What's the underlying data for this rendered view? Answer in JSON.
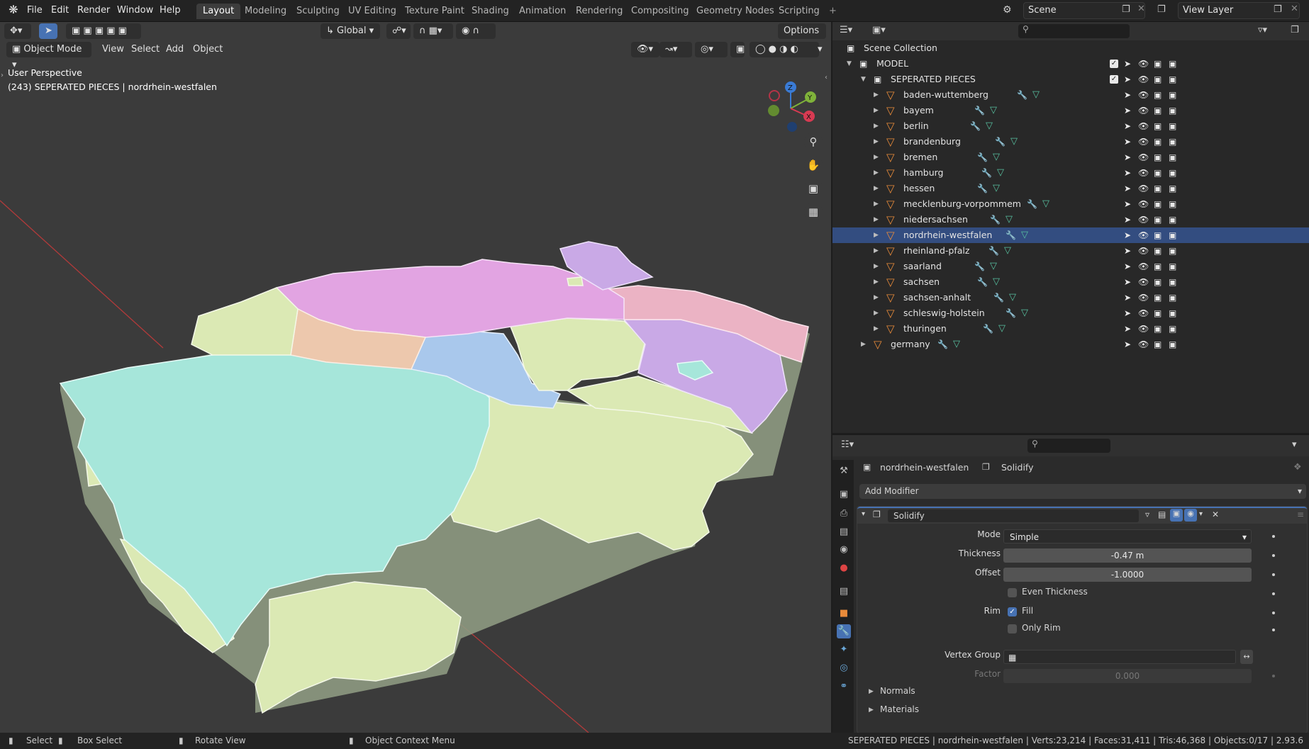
{
  "menu": [
    "File",
    "Edit",
    "Render",
    "Window",
    "Help"
  ],
  "workspaces": [
    "Layout",
    "Modeling",
    "Sculpting",
    "UV Editing",
    "Texture Paint",
    "Shading",
    "Animation",
    "Rendering",
    "Compositing",
    "Geometry Nodes",
    "Scripting"
  ],
  "active_workspace": "Layout",
  "scene": "Scene",
  "view_layer": "View Layer",
  "viewport": {
    "transform": "Global",
    "options": "Options",
    "mode": "Object Mode",
    "menus": [
      "View",
      "Select",
      "Add",
      "Object"
    ],
    "perspective": "User Perspective",
    "info": "(243) SEPERATED PIECES | nordrhein-westfalen",
    "axes": {
      "x": "X",
      "y": "Y",
      "z": "Z"
    }
  },
  "outliner": {
    "root": "Scene Collection",
    "model": "MODEL",
    "collection": "SEPERATED PIECES",
    "items": [
      "baden-wuttemberg",
      "bayem",
      "berlin",
      "brandenburg",
      "bremen",
      "hamburg",
      "hessen",
      "mecklenburg-vorpommem",
      "niedersachsen",
      "nordrhein-westfalen",
      "rheinland-pfalz",
      "saarland",
      "sachsen",
      "sachsen-anhalt",
      "schleswig-holstein",
      "thuringen"
    ],
    "selected": "nordrhein-westfalen",
    "other": "germany"
  },
  "properties": {
    "object": "nordrhein-westfalen",
    "modifier_tab": "Solidify",
    "add_modifier": "Add Modifier",
    "modifier": "Solidify",
    "mode_label": "Mode",
    "mode": "Simple",
    "thickness_label": "Thickness",
    "thickness": "-0.47 m",
    "offset_label": "Offset",
    "offset": "-1.0000",
    "even_thickness": "Even Thickness",
    "rim_label": "Rim",
    "fill": "Fill",
    "only_rim": "Only Rim",
    "vgroup_label": "Vertex Group",
    "factor_label": "Factor",
    "factor": "0.000",
    "normals": "Normals",
    "materials": "Materials"
  },
  "status": {
    "select": "Select",
    "box_select": "Box Select",
    "rotate": "Rotate View",
    "context": "Object Context Menu",
    "stats": "SEPERATED PIECES | nordrhein-westfalen | Verts:23,214 | Faces:31,411 | Tris:46,368 | Objects:0/17 | 2.93.6"
  },
  "colors": {
    "nrw": "#a6e6da",
    "green_yellow": "#dbe9b4",
    "pink": "#e2a4e2",
    "salmon": "#ebb3c4",
    "peach": "#edc8ad",
    "blue": "#a9c8ec",
    "purple": "#c9a9e6",
    "accent": "#4772b3"
  }
}
